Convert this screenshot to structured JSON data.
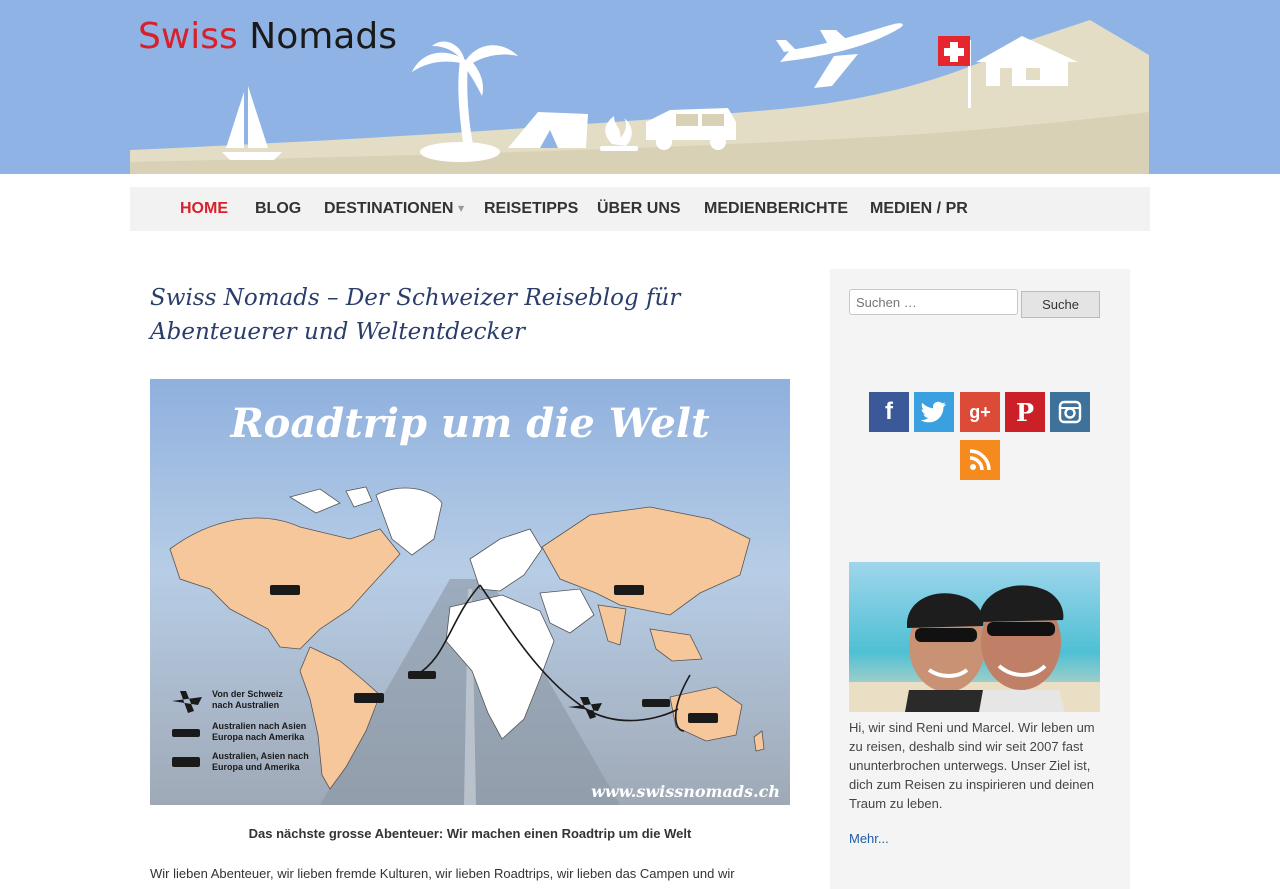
{
  "header": {
    "logo_part1": "Swiss",
    "logo_part2": "Nomads"
  },
  "nav": {
    "items": [
      {
        "label": "HOME",
        "active": true
      },
      {
        "label": "BLOG"
      },
      {
        "label": "DESTINATIONEN",
        "has_submenu": true
      },
      {
        "label": "REISETIPPS"
      },
      {
        "label": "ÜBER UNS"
      },
      {
        "label": "MEDIENBERICHTE"
      },
      {
        "label": "MEDIEN / PR"
      }
    ],
    "accent_color": "#d8202a"
  },
  "main": {
    "title": "Swiss Nomads – Der Schweizer Reiseblog für Abenteuerer und Weltentdecker",
    "hero": {
      "headline": "Roadtrip um die Welt",
      "legend": [
        {
          "icon": "plane-icon",
          "lines": [
            "Von der Schweiz",
            "nach Australien"
          ]
        },
        {
          "icon": "ship-icon",
          "lines": [
            "Australien nach Asien",
            "Europa nach Amerika"
          ]
        },
        {
          "icon": "car-icon",
          "lines": [
            "Australien, Asien nach",
            "Europa und Amerika"
          ]
        }
      ],
      "watermark": "www.swissnomads.ch"
    },
    "caption": "Das nächste grosse Abenteuer: Wir machen einen Roadtrip um die Welt",
    "intro": "Wir lieben Abenteuer, wir lieben fremde Kulturen, wir lieben Roadtrips, wir lieben das Campen und wir"
  },
  "sidebar": {
    "search": {
      "placeholder": "Suchen …",
      "button_label": "Suche"
    },
    "social": [
      {
        "name": "facebook-icon",
        "glyph": "f",
        "color": "#3b5998"
      },
      {
        "name": "twitter-icon",
        "glyph": "t",
        "color": "#3aa0e0"
      },
      {
        "name": "google-plus-icon",
        "glyph": "g+",
        "color": "#dc4a38"
      },
      {
        "name": "pinterest-icon",
        "glyph": "P",
        "color": "#cb2027"
      },
      {
        "name": "instagram-icon",
        "glyph": "",
        "color": "#3f729b"
      },
      {
        "name": "rss-icon",
        "glyph": "",
        "color": "#f58a1f"
      }
    ],
    "bio": "Hi, wir sind Reni und Marcel. Wir leben um zu reisen, deshalb sind wir seit 2007 fast ununterbrochen unterwegs. Unser Ziel ist, dich zum Reisen zu inspirieren und deinen Traum zu leben.",
    "more_link": "Mehr..."
  }
}
